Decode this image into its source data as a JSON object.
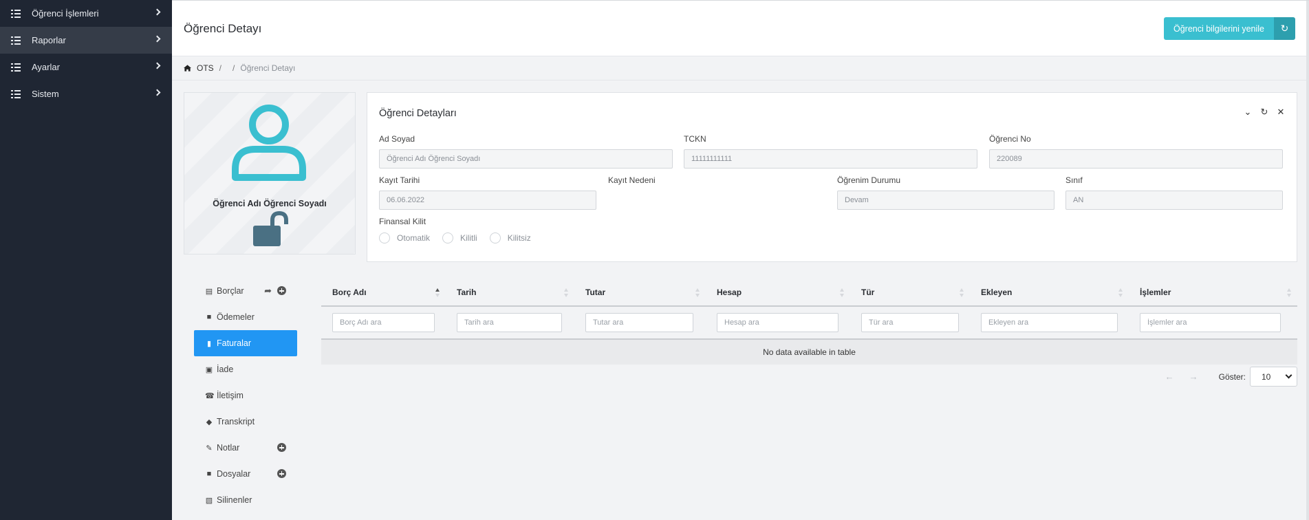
{
  "sidebar": {
    "items": [
      {
        "label": "Öğrenci İşlemleri",
        "icon": "list-icon"
      },
      {
        "label": "Raporlar",
        "icon": "list-icon"
      },
      {
        "label": "Ayarlar",
        "icon": "list-icon"
      },
      {
        "label": "Sistem",
        "icon": "list-icon"
      }
    ],
    "active_index": 1
  },
  "header": {
    "title": "Öğrenci Detayı",
    "refresh_button": "Öğrenci bilgilerini yenile",
    "accent_color": "#3abfd0"
  },
  "breadcrumb": {
    "root": "OTS",
    "sep1": "/",
    "sep2": "/",
    "current": "Öğrenci Detayı"
  },
  "profile": {
    "name": "Öğrenci Adı Öğrenci Soyadı",
    "avatar_icon": "user-icon",
    "lock_icon": "unlock-icon"
  },
  "details": {
    "title": "Öğrenci Detayları",
    "fields": {
      "ad_soyad": {
        "label": "Ad Soyad",
        "value": "Öğrenci Adı Öğrenci Soyadı"
      },
      "tckn": {
        "label": "TCKN",
        "value": "11111111111"
      },
      "ogrenci_no": {
        "label": "Öğrenci No",
        "value": "220089"
      },
      "kayit_tarihi": {
        "label": "Kayıt Tarihi",
        "value": "06.06.2022"
      },
      "kayit_nedeni": {
        "label": "Kayıt Nedeni",
        "value": ""
      },
      "ogrenim_durumu": {
        "label": "Öğrenim Durumu",
        "value": "Devam"
      },
      "sinif": {
        "label": "Sınıf",
        "value": "AN"
      }
    },
    "finansal_kilit": {
      "label": "Finansal Kilit",
      "options": [
        "Otomatik",
        "Kilitli",
        "Kilitsiz"
      ]
    }
  },
  "tabs": [
    {
      "label": "Borçlar",
      "icon": "cash-register-icon"
    },
    {
      "label": "Ödemeler",
      "icon": "file-icon"
    },
    {
      "label": "Faturalar",
      "icon": "receipt-icon"
    },
    {
      "label": "İade",
      "icon": "money-return-icon"
    },
    {
      "label": "İletişim",
      "icon": "phone-icon"
    },
    {
      "label": "Transkript",
      "icon": "graduation-cap-icon"
    },
    {
      "label": "Notlar",
      "icon": "note-edit-icon"
    },
    {
      "label": "Dosyalar",
      "icon": "file-icon"
    },
    {
      "label": "Silinenler",
      "icon": "trash-icon"
    }
  ],
  "active_tab_index": 2,
  "table": {
    "columns": [
      "Borç Adı",
      "Tarih",
      "Tutar",
      "Hesap",
      "Tür",
      "Ekleyen",
      "İşlemler"
    ],
    "filters": [
      "Borç Adı ara",
      "Tarih ara",
      "Tutar ara",
      "Hesap ara",
      "Tür ara",
      "Ekleyen ara",
      "İşlemler ara"
    ],
    "empty_message": "No data available in table",
    "prev": "←",
    "next": "→",
    "page_size_label": "Göster:",
    "page_size": "10"
  }
}
